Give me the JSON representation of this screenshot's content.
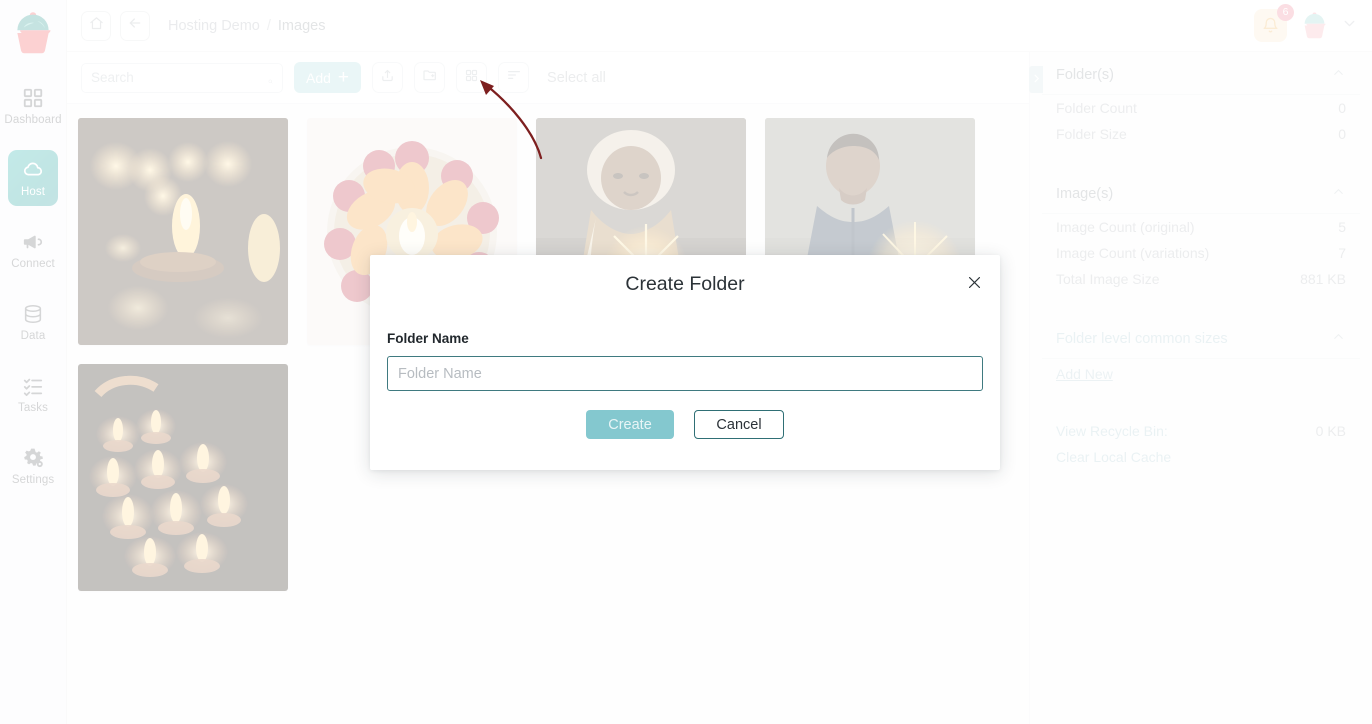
{
  "app": {
    "logo_icon": "cupcake-logo",
    "accent_color": "#22a49f",
    "badge_color": "#f08a9a"
  },
  "sidebar": {
    "items": [
      {
        "label": "Dashboard",
        "icon": "grid-icon",
        "active": false
      },
      {
        "label": "Host",
        "icon": "cloud-icon",
        "active": true
      },
      {
        "label": "Connect",
        "icon": "megaphone-icon",
        "active": false
      },
      {
        "label": "Data",
        "icon": "database-icon",
        "active": false
      },
      {
        "label": "Tasks",
        "icon": "checklist-icon",
        "active": false
      },
      {
        "label": "Settings",
        "icon": "gears-icon",
        "active": false
      }
    ]
  },
  "header": {
    "home_icon": "home-icon",
    "back_icon": "arrow-left-icon",
    "breadcrumb": {
      "root": "Hosting Demo",
      "separator": "/",
      "current": "Images"
    },
    "notifications": {
      "icon": "bell-icon",
      "count": "6"
    },
    "avatar_icon": "cupcake-avatar",
    "dropdown_icon": "chevron-down-icon"
  },
  "toolbar": {
    "search": {
      "value": "",
      "placeholder": "Search",
      "icon": "search-icon"
    },
    "add_label": "Add",
    "add_plus": "+",
    "upload_icon": "upload-icon",
    "create_folder_icon": "folder-plus-icon",
    "grid_view_icon": "grid-view-icon",
    "sort_icon": "sort-icon",
    "select_all_label": "Select all"
  },
  "gallery": {
    "items": [
      {
        "name": "diwali-diya-candles",
        "alt": "Lit diya lamps and candles"
      },
      {
        "name": "flower-bowl-candle",
        "alt": "Floral bowl with candle"
      },
      {
        "name": "woman-with-sparkler",
        "alt": "Woman holding sparkler"
      },
      {
        "name": "man-with-sparkler",
        "alt": "Man holding sparkler"
      },
      {
        "name": "many-oil-lamps",
        "alt": "Rows of lit oil lamps"
      }
    ]
  },
  "right_panel": {
    "toggle_icon": "chevron-right-icon",
    "sections": [
      {
        "title": "Folder(s)",
        "collapse_icon": "chevron-up-icon",
        "rows": [
          {
            "key": "Folder Count",
            "value": "0"
          },
          {
            "key": "Folder Size",
            "value": "0"
          }
        ]
      },
      {
        "title": "Image(s)",
        "collapse_icon": "chevron-up-icon",
        "rows": [
          {
            "key": "Image Count (original)",
            "value": "5"
          },
          {
            "key": "Image Count (variations)",
            "value": "7"
          },
          {
            "key": "Total Image Size",
            "value": "881 KB"
          }
        ]
      },
      {
        "title": "Folder level common sizes",
        "collapse_icon": "chevron-up-icon",
        "link": "Add New",
        "rows": []
      }
    ],
    "footer": {
      "recycle_bin_label": "View Recycle Bin:",
      "recycle_bin_value": "0 KB",
      "clear_cache_label": "Clear Local Cache"
    }
  },
  "annotation": {
    "type": "curved-arrow",
    "color": "#7d1f1f",
    "points_to": "create-folder-toolbar-button"
  },
  "modal": {
    "title": "Create Folder",
    "close_icon": "close-icon",
    "field_label": "Folder Name",
    "field_value": "",
    "field_placeholder": "Folder Name",
    "create_label": "Create",
    "cancel_label": "Cancel"
  }
}
